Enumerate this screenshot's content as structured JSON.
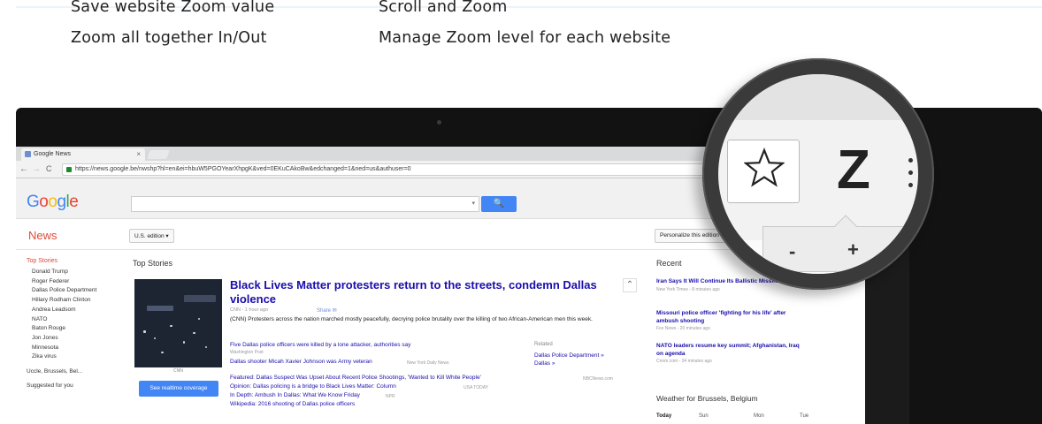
{
  "promo": {
    "features": [
      "Save website Zoom value",
      "Scroll and Zoom",
      "Zoom all together In/Out",
      "Manage Zoom level for each website"
    ]
  },
  "browser": {
    "tab_title": "Google News",
    "tab_close": "×",
    "back": "←",
    "forward": "→",
    "reload": "C",
    "url": "https://news.google.be/nwshp?hl=en&ei=hbuW5PGOYearXhpgK&ved=0EKuCAkoBw&edchanged=1&ned=us&authuser=0"
  },
  "google": {
    "logo": [
      "G",
      "o",
      "o",
      "g",
      "l",
      "e"
    ],
    "search_button": "🔍",
    "search_caret": "▾"
  },
  "news": {
    "section_title": "News",
    "edition": "U.S. edition ▾",
    "personalize": "Personalize this edition",
    "left_nav": {
      "top_stories": "Top Stories",
      "items": [
        "Donald Trump",
        "Roger Federer",
        "Dallas Police Department",
        "Hillary Rodham Clinton",
        "Andrea Leadsom",
        "NATO",
        "Baton Rouge",
        "Jon Jones",
        "Minnesota",
        "Zika virus",
        "Uccle, Brussels, Bel..."
      ],
      "suggested": "Suggested for you"
    },
    "top_stories_title": "Top Stories",
    "story": {
      "headline": "Black Lives Matter protesters return to the streets, condemn Dallas violence",
      "source_time": "CNN - 1 hour ago",
      "share": "Share ✉",
      "snippet": "(CNN) Protesters across the nation marched mostly peacefully, decrying police brutality over the killing of two African-American men this week.",
      "image_credit": "CNN",
      "realtime_button": "See realtime coverage",
      "links": [
        {
          "text": "Five Dallas police officers were killed by a lone attacker, authorities say",
          "source": "Washington Post"
        },
        {
          "text": "Dallas shooter Micah Xavier Johnson was Army veteran",
          "source": "New York Daily News"
        }
      ],
      "related_label": "Related",
      "related_links": [
        "Dallas Police Department »",
        "Dallas »"
      ],
      "featured": "Featured: Dallas Suspect Was Upset About Recent Police Shootings, 'Wanted to Kill White People'",
      "featured_source": "NBCNews.com",
      "opinion": "Opinion: Dallas policing is a bridge to Black Lives Matter: Column",
      "opinion_source": "USA TODAY",
      "in_depth": "In Depth: Ambush In Dallas: What We Know Friday",
      "in_depth_source": "NPR",
      "wikipedia": "Wikipedia: 2016 shooting of Dallas police officers"
    },
    "recent_title": "Recent",
    "recent": [
      {
        "title": "Iran Says It Will Continue Its Ballistic Missile Program",
        "meta": "New York Times - 8 minutes ago"
      },
      {
        "title": "Missouri police officer 'fighting for his life' after ambush shooting",
        "meta": "Fox News - 20 minutes ago"
      },
      {
        "title": "NATO leaders resume key summit; Afghanistan, Iraq on agenda",
        "meta": "Cnnm.com - 34 minutes ago"
      }
    ],
    "weather_title": "Weather for Brussels, Belgium",
    "weather_days": [
      "Today",
      "Sun",
      "Mon",
      "Tue"
    ]
  },
  "zoom_popup": {
    "icon_letter": "Z",
    "minus": "-",
    "plus": "+"
  },
  "colors": {
    "accent_blue": "#4285f4",
    "news_red": "#dd4b39",
    "link_blue": "#1a0dab"
  }
}
